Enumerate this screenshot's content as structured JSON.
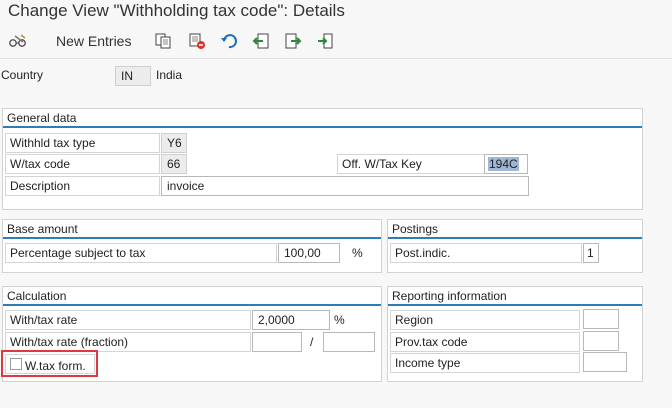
{
  "window": {
    "title": "Change View \"Withholding tax code\": Details"
  },
  "toolbar": {
    "new_entries": "New Entries",
    "icons": [
      "glasses-icon",
      "copy-icon",
      "delete-icon",
      "undo-icon",
      "previous-entry-icon",
      "next-entry-icon",
      "select-icon"
    ]
  },
  "header": {
    "country_label": "Country",
    "country_code": "IN",
    "country_name": "India"
  },
  "general": {
    "title": "General data",
    "type_label": "Withhld tax type",
    "type_value": "Y6",
    "code_label": "W/tax code",
    "code_value": "66",
    "offkey_label": "Off. W/Tax Key",
    "offkey_value": "194C",
    "desc_label": "Description",
    "desc_value": "invoice"
  },
  "base": {
    "title": "Base amount",
    "pct_label": "Percentage subject to tax",
    "pct_value": "100,00",
    "pct_unit": "%"
  },
  "postings": {
    "title": "Postings",
    "post_label": "Post.indic.",
    "post_value": "1"
  },
  "calculation": {
    "title": "Calculation",
    "rate_label": "With/tax rate",
    "rate_value": "2,0000",
    "rate_unit": "%",
    "frac_label": "With/tax rate (fraction)",
    "frac_sep": "/",
    "frac_num": "",
    "frac_den": "",
    "form_label": "W.tax form."
  },
  "reporting": {
    "title": "Reporting information",
    "region_label": "Region",
    "region_value": "",
    "prov_label": "Prov.tax code",
    "prov_value": "",
    "income_label": "Income type",
    "income_value": ""
  },
  "colors": {
    "accent": "#2f7db8",
    "highlight": "#e0383e",
    "selected": "#9fb7d4"
  }
}
